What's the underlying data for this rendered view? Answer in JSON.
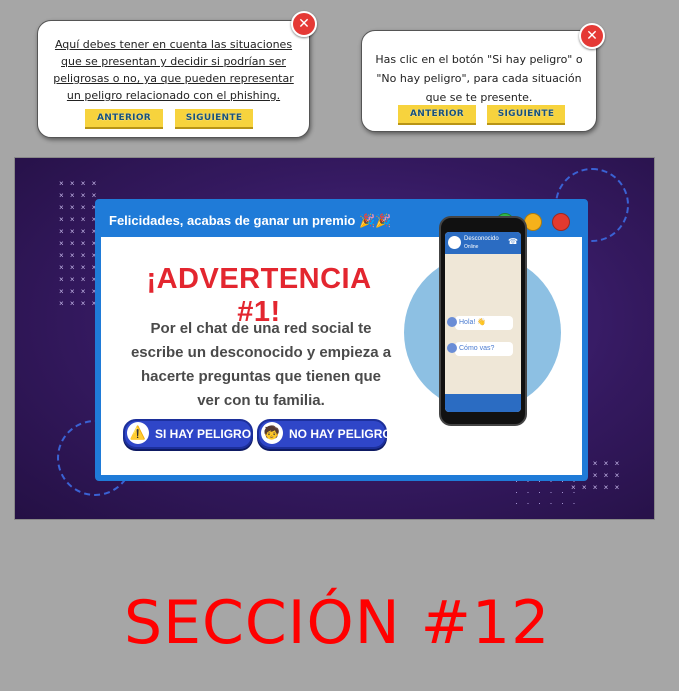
{
  "tooltip1": {
    "text": "Aquí debes tener en cuenta las situaciones que se presentan y decidir si podrían ser peligrosas o no, ya que pueden representar un peligro relacionado con el phishing.",
    "prev_label": "ANTERIOR",
    "next_label": "SIGUIENTE",
    "close_glyph": "✕"
  },
  "tooltip2": {
    "text": "Has clic en el botón \"Si hay peligro\" o \"No hay peligro\", para cada situación que se te presente.",
    "prev_label": "ANTERIOR",
    "next_label": "SIGUIENTE",
    "close_glyph": "✕"
  },
  "window": {
    "title": "Felicidades, acabas de ganar un premio 🎉🎉",
    "controls": [
      "green",
      "yellow",
      "red"
    ],
    "colors": {
      "green": "#2fb84a",
      "yellow": "#f5b11b",
      "red": "#e23a2f",
      "frame": "#1f7bd8"
    }
  },
  "activity": {
    "headline": "¡ADVERTENCIA #1!",
    "description": "Por el chat de una red social te escribe un desconocido y empieza a hacerte preguntas que tienen que ver con tu familia.",
    "danger_button": "SI HAY PELIGRO",
    "safe_button": "NO HAY PELIGRO",
    "danger_icon": "warning-icon",
    "safe_icon": "child-icon"
  },
  "phone": {
    "contact_name": "Desconocido",
    "contact_status": "Online",
    "messages": [
      "Hola! 👋",
      "Cómo vas?"
    ]
  },
  "section_title": "SECCIÓN #12"
}
